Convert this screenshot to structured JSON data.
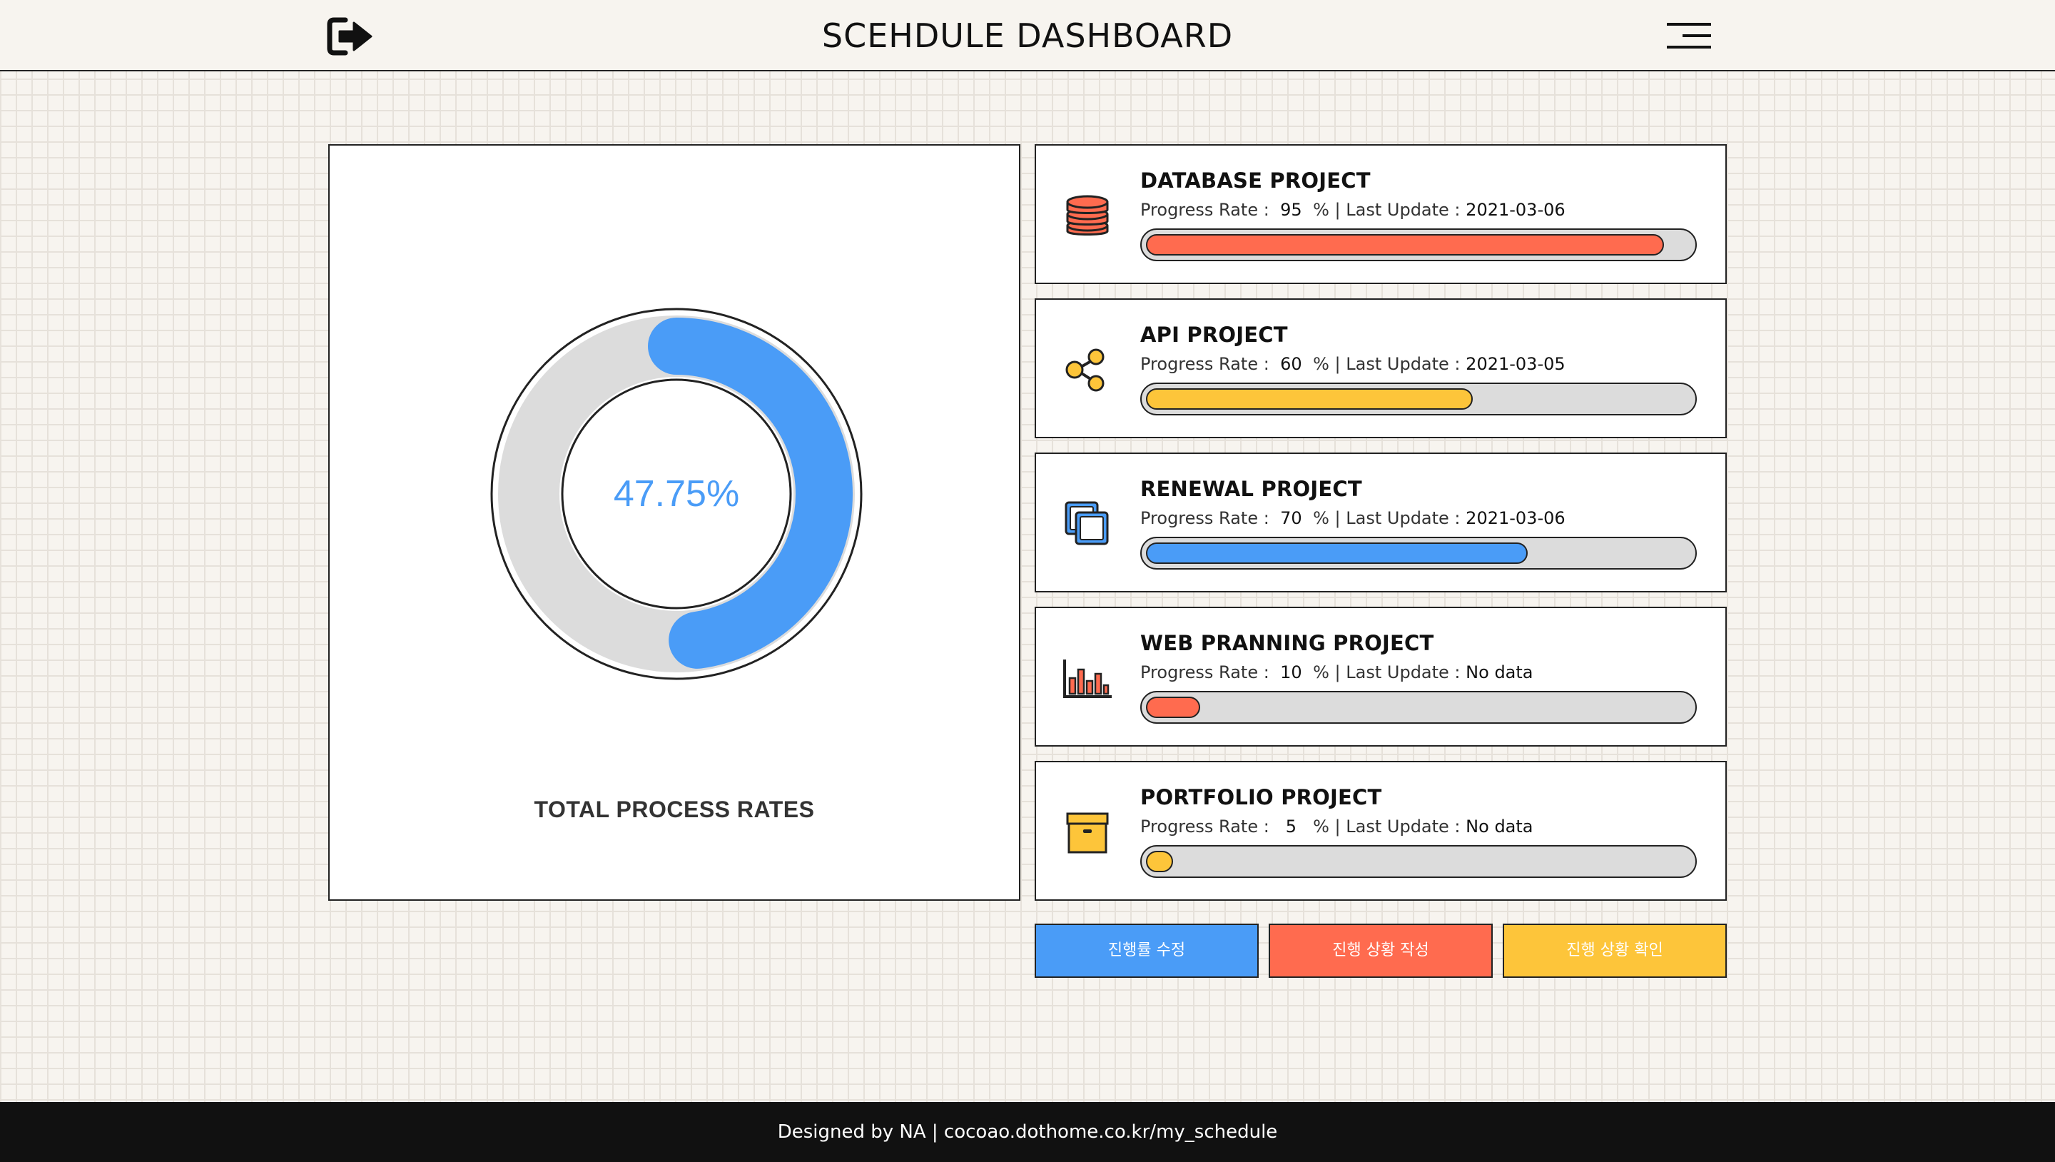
{
  "header": {
    "title": "SCEHDULE DASHBOARD",
    "logout_icon": "logout-icon",
    "menu_icon": "hamburger-menu-icon"
  },
  "total": {
    "percent_text": "47.75%",
    "percent_value": 47.75,
    "label": "TOTAL PROCESS RATES",
    "fill_color": "#4a9cf7",
    "track_color": "#dcdcdc"
  },
  "projects": [
    {
      "name": "DATABASE PROJECT",
      "rate_label": "Progress Rate :",
      "rate": "95",
      "unit": "%",
      "separator": "|",
      "update_label": "Last Update :",
      "last_update": "2021-03-06",
      "progress": 95,
      "color": "#ff6b4f",
      "icon": "database-icon"
    },
    {
      "name": "API PROJECT",
      "rate_label": "Progress Rate :",
      "rate": "60",
      "unit": "%",
      "separator": "|",
      "update_label": "Last Update :",
      "last_update": "2021-03-05",
      "progress": 60,
      "color": "#fdc53a",
      "icon": "share-nodes-icon"
    },
    {
      "name": "RENEWAL PROJECT",
      "rate_label": "Progress Rate :",
      "rate": "70",
      "unit": "%",
      "separator": "|",
      "update_label": "Last Update :",
      "last_update": "2021-03-06",
      "progress": 70,
      "color": "#4a9cf7",
      "icon": "copy-squares-icon"
    },
    {
      "name": "WEB PRANNING PROJECT",
      "rate_label": "Progress Rate :",
      "rate": "10",
      "unit": "%",
      "separator": "|",
      "update_label": "Last Update :",
      "last_update": "No data",
      "progress": 10,
      "color": "#ff6b4f",
      "icon": "bar-chart-icon"
    },
    {
      "name": "PORTFOLIO PROJECT",
      "rate_label": "Progress Rate :",
      "rate": "5",
      "unit": "%",
      "separator": "|",
      "update_label": "Last Update :",
      "last_update": "No data",
      "progress": 5,
      "color": "#fdc53a",
      "icon": "archive-box-icon"
    }
  ],
  "actions": [
    {
      "label": "진행률 수정",
      "color": "#4a9cf7"
    },
    {
      "label": "진행 상황 작성",
      "color": "#ff6b4f"
    },
    {
      "label": "진행 상황 확인",
      "color": "#fdc53a"
    }
  ],
  "footer": {
    "text": "Designed by NA | cocoao.dothome.co.kr/my_schedule"
  }
}
